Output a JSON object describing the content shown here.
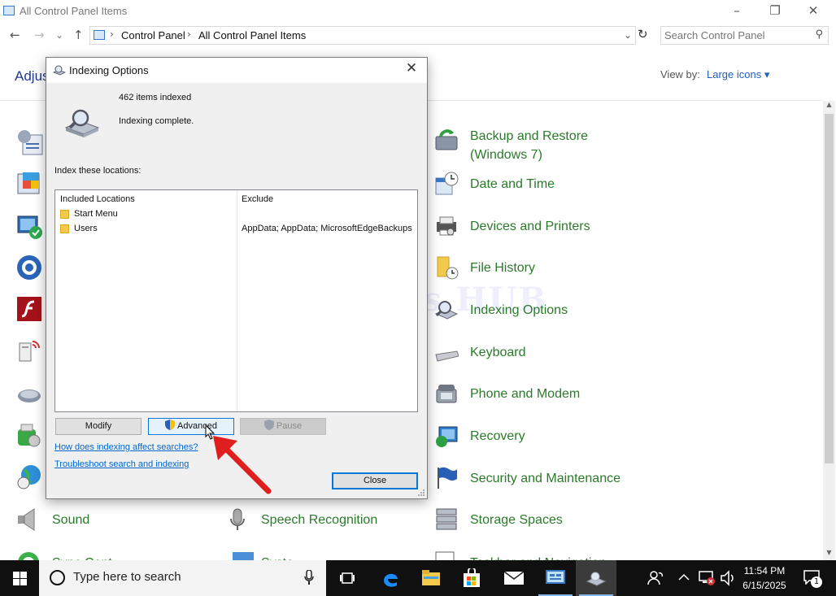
{
  "window": {
    "title": "All Control Panel Items",
    "controls": {
      "minimize": "–",
      "maximize": "❐",
      "close": "✕"
    }
  },
  "nav": {
    "back": "←",
    "forward": "→",
    "recent": "⌄",
    "up": "↑",
    "refresh": "↻"
  },
  "address": {
    "crumbs": [
      "Control Panel",
      "All Control Panel Items"
    ],
    "separator": "›",
    "dropdown": "⌄"
  },
  "search": {
    "placeholder": "Search Control Panel"
  },
  "header": {
    "title": "Adjus",
    "view_by_label": "View by:",
    "view_by_value": "Large icons ▾"
  },
  "items": {
    "backup": {
      "label": "Backup and Restore\n(Windows 7)",
      "icon": "backup-icon"
    },
    "datetime": {
      "label": "Date and Time",
      "icon": "clock-icon"
    },
    "devices": {
      "label": "Devices and Printers",
      "icon": "printer-icon"
    },
    "filehistory": {
      "label": "File History",
      "icon": "file-history-icon"
    },
    "indexing": {
      "label": "Indexing Options",
      "icon": "indexing-icon"
    },
    "keyboard": {
      "label": "Keyboard",
      "icon": "keyboard-icon"
    },
    "phone": {
      "label": "Phone and Modem",
      "icon": "phone-icon"
    },
    "recovery": {
      "label": "Recovery",
      "icon": "recovery-icon"
    },
    "security": {
      "label": "Security and Maintenance",
      "icon": "flag-icon"
    },
    "sound": {
      "label": "Sound",
      "icon": "speaker-icon"
    },
    "speech": {
      "label": "Speech Recognition",
      "icon": "microphone-icon"
    },
    "storage": {
      "label": "Storage Spaces",
      "icon": "storage-icon"
    },
    "sync": {
      "label": "Sync Cent",
      "icon": "sync-icon"
    },
    "system": {
      "label": "Syste",
      "icon": "system-icon"
    },
    "taskbar_nav": {
      "label": "Taskbar and Navigation",
      "icon": "taskbar-icon"
    }
  },
  "dialog": {
    "title": "Indexing Options",
    "items_indexed": "462 items indexed",
    "status": "Indexing complete.",
    "index_label": "Index these locations:",
    "columns": {
      "included": "Included Locations",
      "exclude": "Exclude"
    },
    "locations": [
      {
        "name": "Start Menu",
        "exclude": ""
      },
      {
        "name": "Users",
        "exclude": "AppData; AppData; MicrosoftEdgeBackups"
      }
    ],
    "buttons": {
      "modify": "Modify",
      "advanced": "Advanced",
      "pause": "Pause",
      "close": "Close"
    },
    "links": {
      "how": "How does indexing affect searches?",
      "troubleshoot": "Troubleshoot search and indexing"
    },
    "close_glyph": "✕"
  },
  "watermark": "IT Pros HUB",
  "taskbar": {
    "search_placeholder": "Type here to search",
    "time": "11:54 PM",
    "date": "6/15/2025",
    "notification_count": "1",
    "apps": [
      "task-view-icon",
      "edge-icon",
      "file-explorer-icon",
      "store-icon",
      "mail-icon",
      "control-panel-icon",
      "indexing-options-icon"
    ]
  },
  "colors": {
    "link": "#0066cc",
    "item_label": "#2a7a2a",
    "accent": "#0078d7",
    "taskbar": "#101010"
  }
}
